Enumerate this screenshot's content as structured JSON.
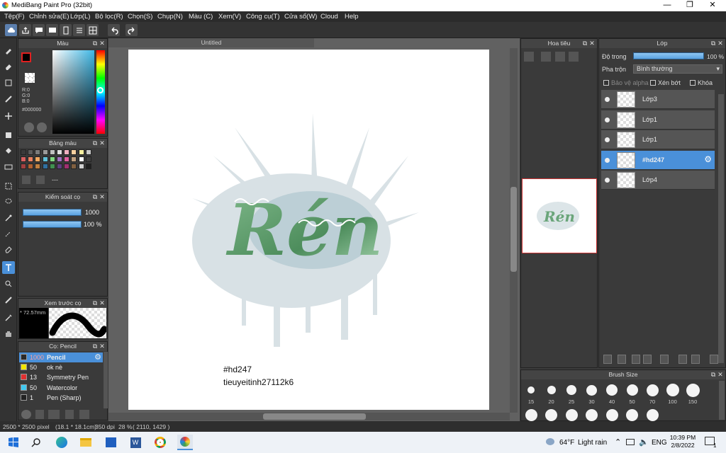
{
  "window": {
    "title": "MediBang Paint Pro (32bit)",
    "minimize": "—",
    "maximize": "❐",
    "close": "✕"
  },
  "menu": [
    "Tệp(F)",
    "Chỉnh sửa(E)",
    "Lớp(L)",
    "Bộ lọc(R)",
    "Chọn(S)",
    "Chụp(N)",
    "Màu (C)",
    "Xem(V)",
    "Công cụ(T)",
    "Cửa sổ(W)",
    "Cloud",
    "Help"
  ],
  "canvas": {
    "tab_title": "Untitled",
    "text_line1": "#hd247",
    "text_line2": "tieuyeitinh27112k6",
    "art_word": "Rén"
  },
  "color_panel": {
    "title": "Màu",
    "r": "R:0",
    "g": "G:0",
    "b": "B:0",
    "hex": "#000000"
  },
  "palette_panel": {
    "title": "Bảng màu",
    "dash": "---",
    "swatches": [
      "#3a3a3a",
      "#5a5a5a",
      "#7a7a7a",
      "#9a9a9a",
      "#bfbfbf",
      "#e0e0e0",
      "#f0b0c0",
      "#f8d0a0",
      "#f8f0a0",
      "#c8c8c8",
      "#d86060",
      "#e88060",
      "#f0a860",
      "#60c0d8",
      "#80d880",
      "#a070c0",
      "#e060a0",
      "#c0a080",
      "#f8f8f8",
      "#404040",
      "#a04040",
      "#b06030",
      "#c08040",
      "#3070a0",
      "#409050",
      "#604080",
      "#a03070",
      "#806040",
      "#d0d0d0",
      "#202020"
    ]
  },
  "brush_control": {
    "title": "Kiểm soát cọ",
    "size": "1000",
    "opacity": "100 %"
  },
  "brush_preview": {
    "title": "Xem trước cọ",
    "size": "72.57mm"
  },
  "brush_list": {
    "title": "Cọ: Pencil",
    "items": [
      {
        "size": "1000",
        "name": "Pencil",
        "color": "#2a2a2a"
      },
      {
        "size": "50",
        "name": "ok nè",
        "color": "#f2e500"
      },
      {
        "size": "13",
        "name": "Symmetry Pen",
        "color": "#e03030"
      },
      {
        "size": "50",
        "name": "Watercolor",
        "color": "#40c8f0"
      },
      {
        "size": "1",
        "name": "Pen (Sharp)",
        "color": "#222222"
      }
    ]
  },
  "navigator": {
    "title": "Hoa tiêu"
  },
  "layers": {
    "title": "Lớp",
    "opacity_label": "Độ trong",
    "opacity_value": "100 %",
    "blend_label": "Pha trộn",
    "blend_value": "Bình thường",
    "protect_alpha": "Bảo vệ alpha",
    "clipping": "Xén bớt",
    "lock": "Khóa",
    "items": [
      {
        "name": "Lớp3",
        "selected": false
      },
      {
        "name": "Lớp1",
        "selected": false
      },
      {
        "name": "Lớp1",
        "selected": false
      },
      {
        "name": "#hd247",
        "selected": true
      },
      {
        "name": "Lớp4",
        "selected": false
      }
    ]
  },
  "brush_size": {
    "title": "Brush Size",
    "sizes": [
      "15",
      "20",
      "25",
      "30",
      "40",
      "50",
      "70",
      "100",
      "150"
    ]
  },
  "status": {
    "dims": "2500 * 2500 pixel",
    "phys": "(18.1 * 18.1cm)",
    "dpi": "350 dpi",
    "zoom": "28 %",
    "coords": "( 2110, 1429 )"
  },
  "taskbar": {
    "weather_temp": "64°F",
    "weather_desc": "Light rain",
    "lang": "ENG",
    "time": "10:39 PM",
    "date": "2/8/2022",
    "notif": "1"
  }
}
